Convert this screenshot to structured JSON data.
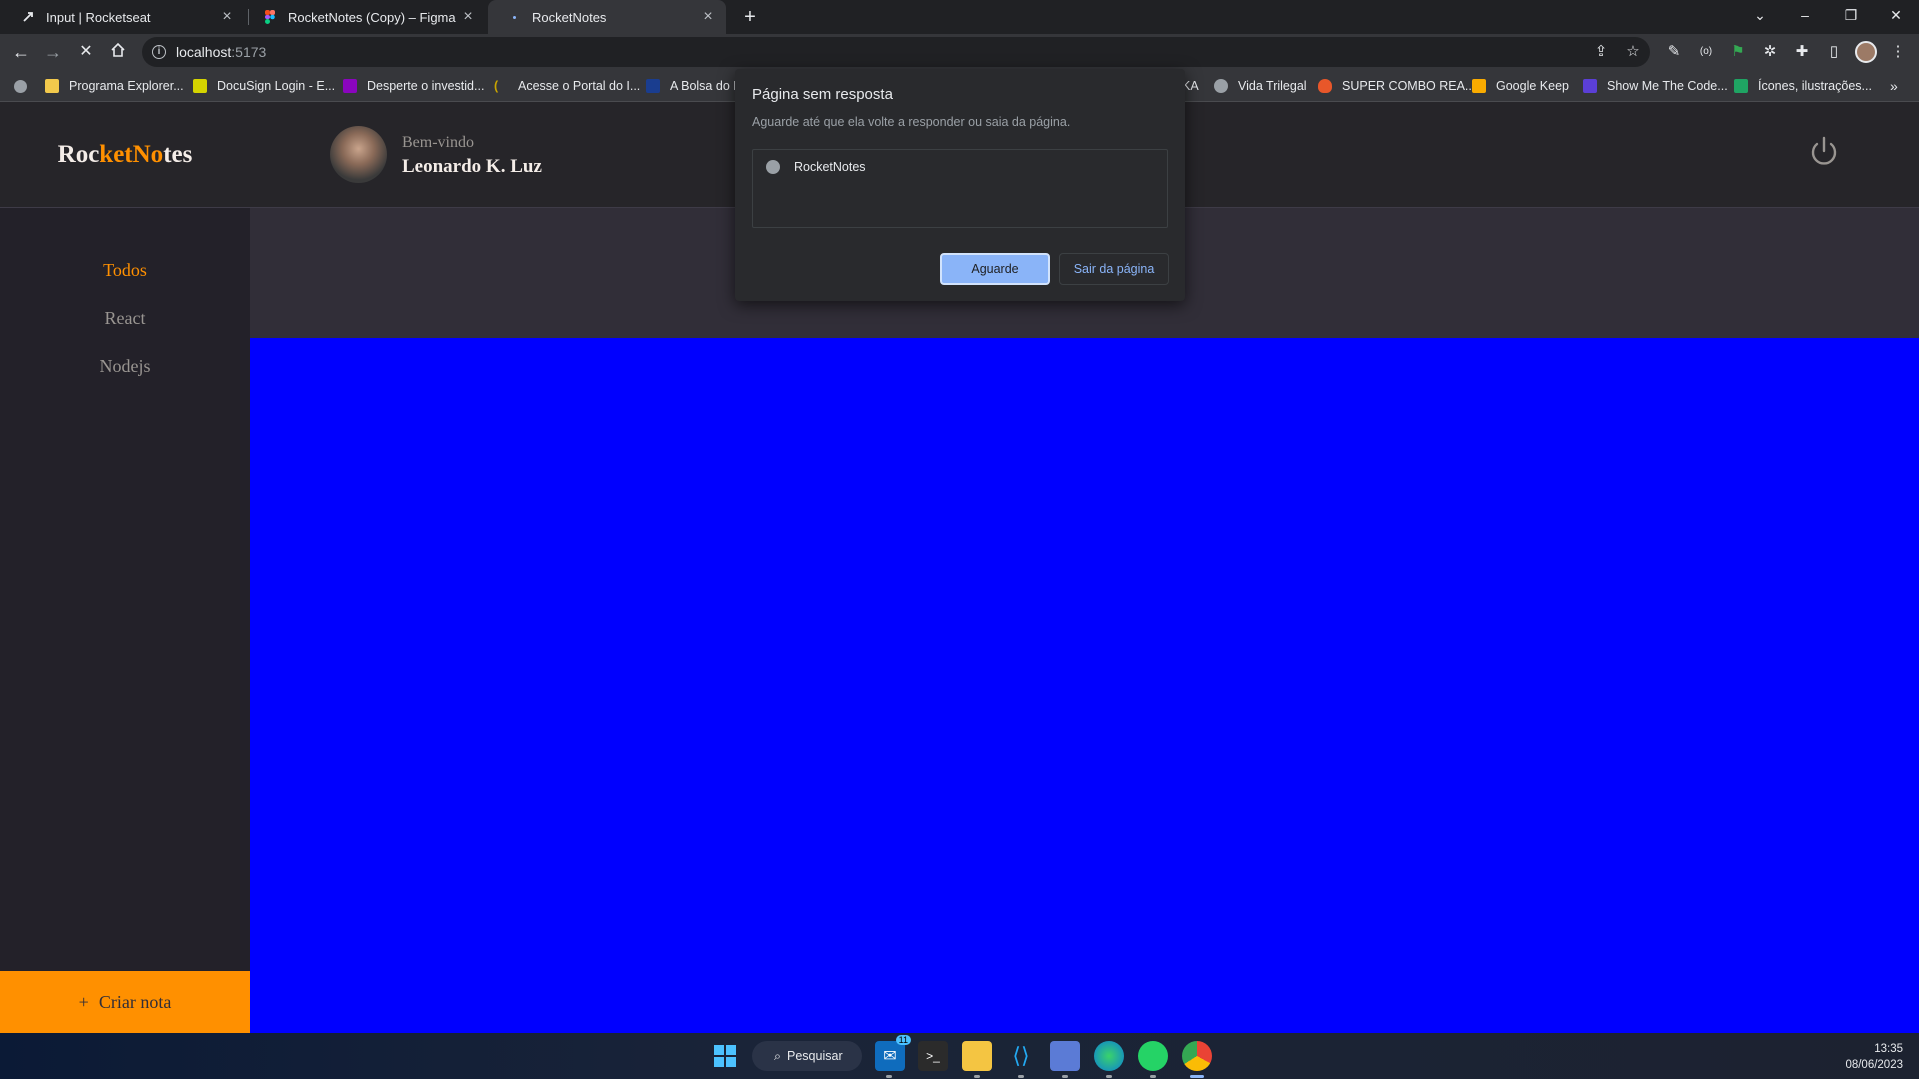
{
  "browser": {
    "tabs": [
      {
        "label": "Input | Rocketseat",
        "icon": "rocketseat-icon"
      },
      {
        "label": "RocketNotes (Copy) – Figma",
        "icon": "figma-icon"
      },
      {
        "label": "RocketNotes",
        "icon": "loading-icon",
        "active": true
      }
    ],
    "address": {
      "host": "localhost",
      "port": ":5173"
    },
    "bookmarks": [
      {
        "label": "Programa Explorer...",
        "color": "#f2c94c"
      },
      {
        "label": "DocuSign Login - E...",
        "color": "#d4d400"
      },
      {
        "label": "Desperte o investid...",
        "color": "#8a05be"
      },
      {
        "label": "Acesse o Portal do I...",
        "color": "#c8a400"
      },
      {
        "label": "A Bolsa do B",
        "color": "#1a3d8f"
      },
      {
        "label": "KA",
        "color": ""
      },
      {
        "label": "Vida Trilegal",
        "color": "#9aa0a6"
      },
      {
        "label": "SUPER COMBO REA...",
        "color": "#e8572a"
      },
      {
        "label": "Google Keep",
        "color": "#f9ab00"
      },
      {
        "label": "Show Me The Code...",
        "color": "#5b3fd6"
      },
      {
        "label": "Ícones, ilustrações...",
        "color": "#1fa463"
      }
    ]
  },
  "app": {
    "brand": {
      "p1": "Roc",
      "p2": "ket",
      "p3": "No",
      "p4": "tes"
    },
    "header": {
      "welcome": "Bem-vindo",
      "username": "Leonardo K. Luz"
    },
    "nav": [
      "Todos",
      "React",
      "Nodejs"
    ],
    "create_label": "Criar nota",
    "colors": {
      "accent": "#ff9000",
      "content": "#0000ff"
    }
  },
  "dialog": {
    "title": "Página sem resposta",
    "subtitle": "Aguarde até que ela volte a responder ou saia da página.",
    "item": "RocketNotes",
    "wait_label": "Aguarde",
    "leave_label": "Sair da página"
  },
  "taskbar": {
    "search_label": "Pesquisar",
    "mail_badge": "11",
    "time": "13:35",
    "date": "08/06/2023"
  }
}
